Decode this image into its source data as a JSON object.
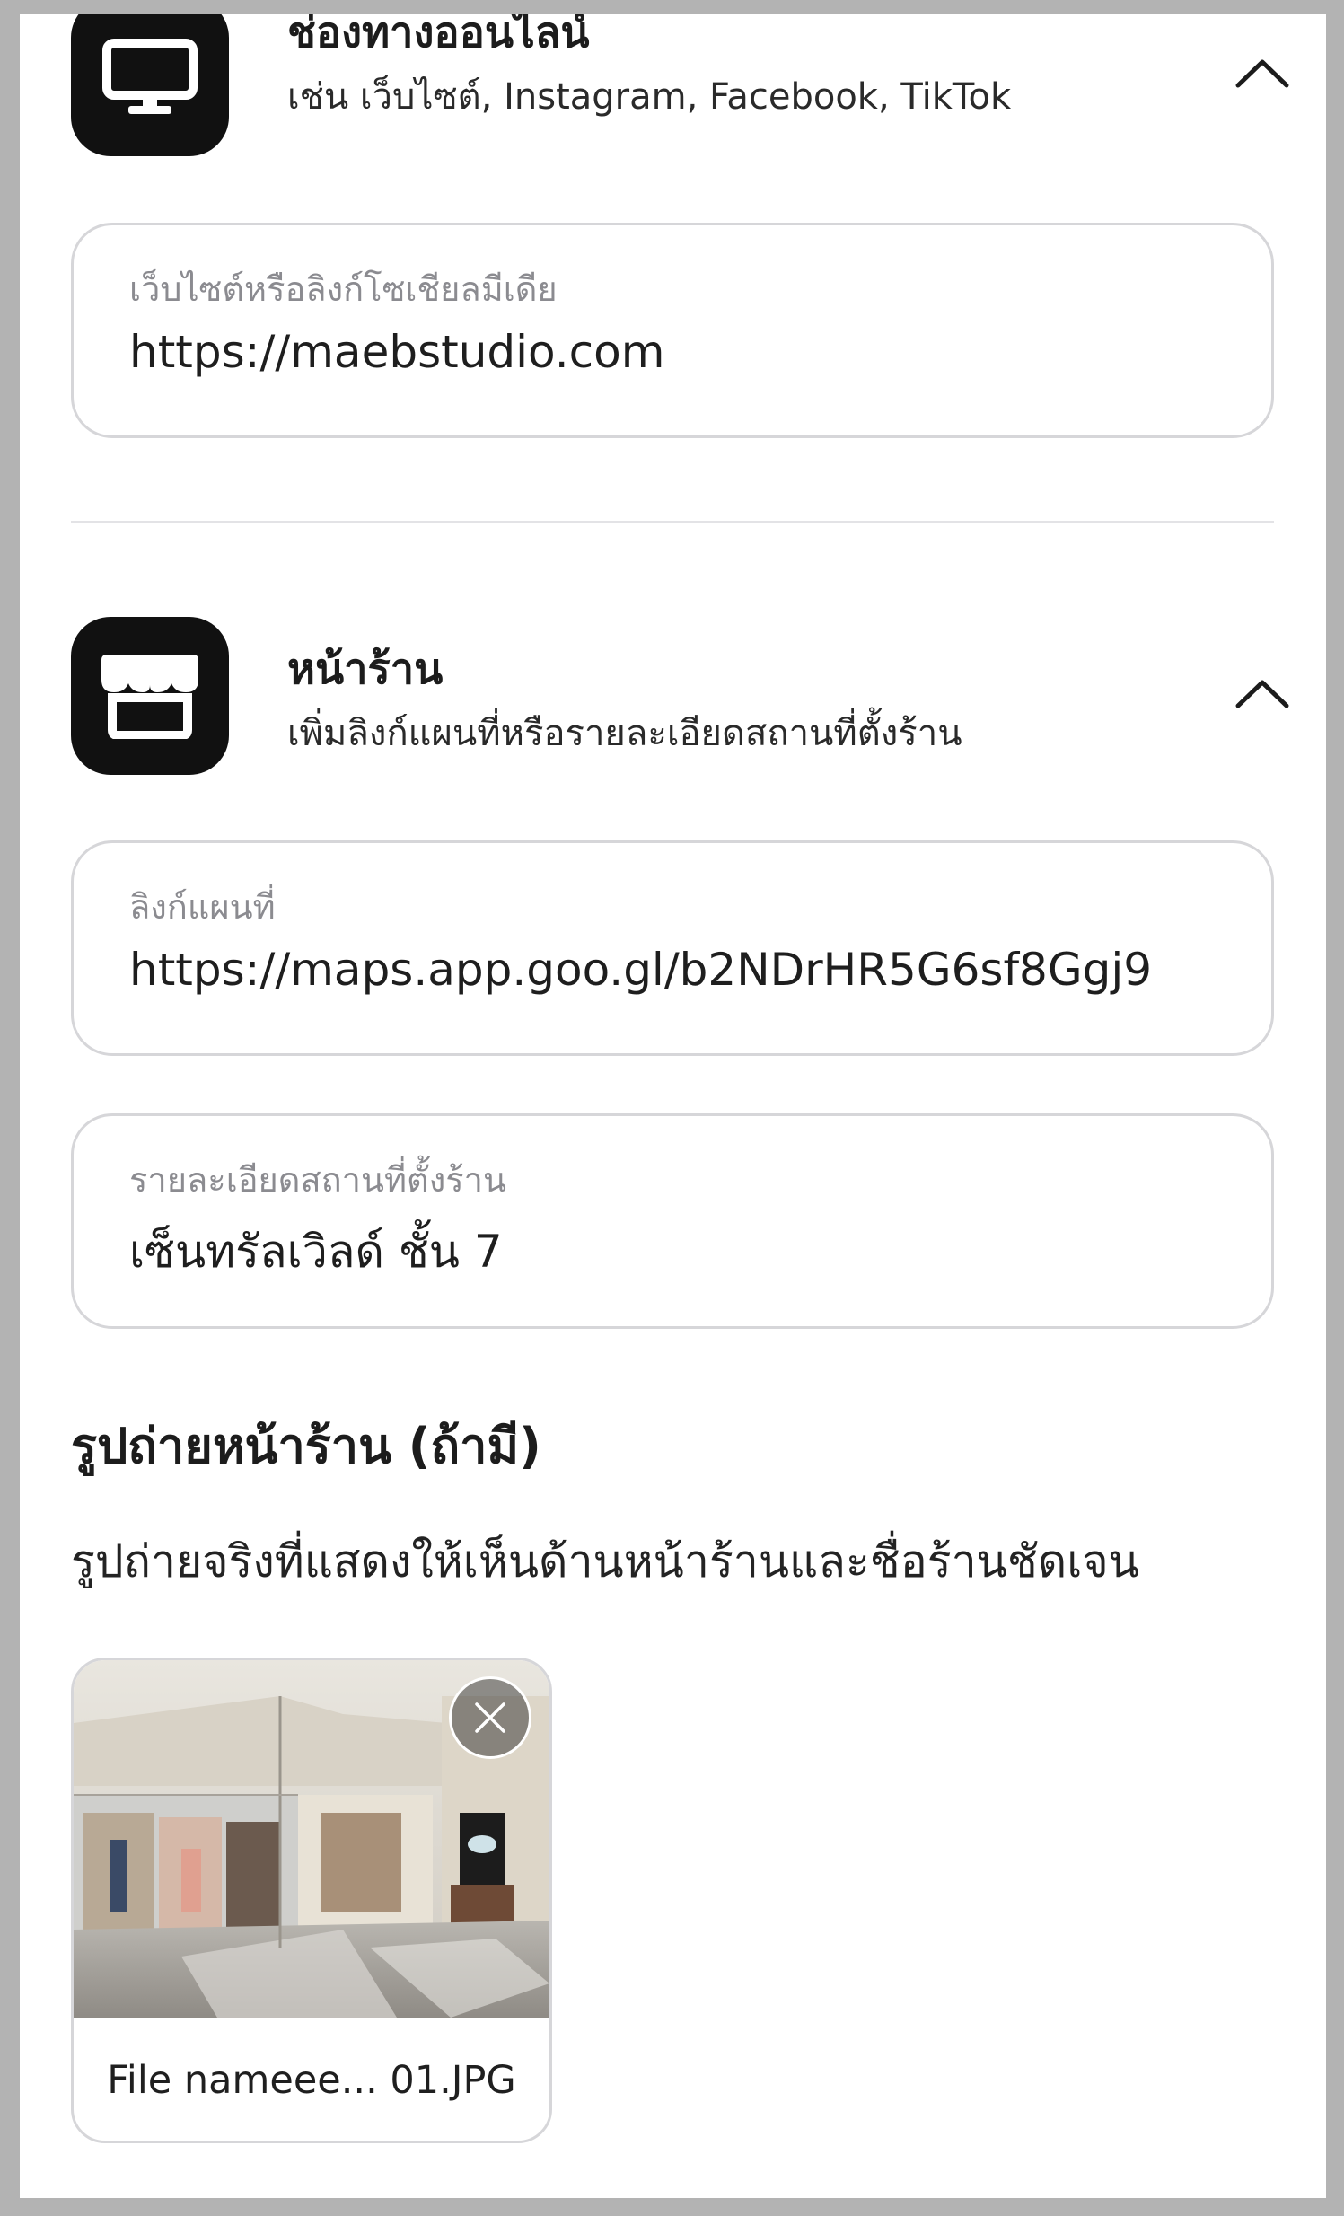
{
  "online": {
    "title": "ช่องทางออนไลน์",
    "subtitle": "เช่น เว็บไซต์, Instagram, Facebook, TikTok",
    "icon": "monitor-icon",
    "field": {
      "label": "เว็บไซต์หรือลิงก์โซเชียลมีเดีย",
      "value": "https://maebstudio.com"
    }
  },
  "storefront": {
    "title": "หน้าร้าน",
    "subtitle": "เพิ่มลิงก์แผนที่หรือรายละเอียดสถานที่ตั้งร้าน",
    "icon": "storefront-icon",
    "map_field": {
      "label": "ลิงก์แผนที่",
      "value": "https://maps.app.goo.gl/b2NDrHR5G6sf8Ggj9"
    },
    "location_field": {
      "label": "รายละเอียดสถานที่ตั้งร้าน",
      "value": "เซ็นทรัลเวิลด์ ชั้น 7"
    },
    "photo": {
      "title": "รูปถ่ายหน้าร้าน (ถ้ามี)",
      "description": "รูปถ่ายจริงที่แสดงให้เห็นด้านหน้าร้านและชื่อร้านชัดเจน",
      "file_name": "File nameee... 01.JPG"
    }
  },
  "colors": {
    "icon_tile": "#111111",
    "field_border": "#d6d6d9",
    "label_gray": "#8b8b90"
  }
}
